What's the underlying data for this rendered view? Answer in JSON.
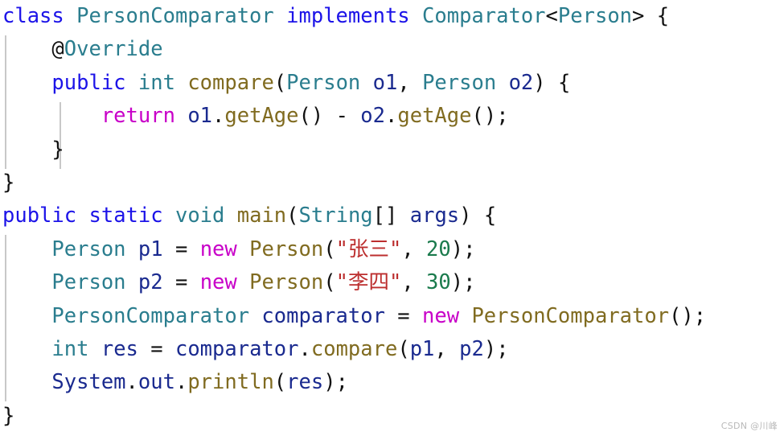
{
  "editor": {
    "language": "java",
    "background_color": "#ffffff",
    "font_size_px": 25.5,
    "line_height_px": 41.4,
    "total_lines": 13,
    "palette": {
      "keyword": "#1c13e8",
      "type": "#2a7d8e",
      "identifier": "#1a2a8f",
      "method": "#806b20",
      "control": "#c800c8",
      "string": "#bc2e2e",
      "number": "#1a7a4c",
      "punctuation": "#111111",
      "indent_guide": "#c8c8c8",
      "watermark": "#b9b9b9"
    },
    "full_source": "class PersonComparator implements Comparator<Person> {\n    @Override\n    public int compare(Person o1, Person o2) {\n        return o1.getAge() - o2.getAge();\n    }\n}\npublic static void main(String[] args) {\n    Person p1 = new Person(\"张三\", 20);\n    Person p2 = new Person(\"李四\", 30);\n    PersonComparator comparator = new PersonComparator();\n    int res = comparator.compare(p1, p2);\n    System.out.println(res);\n}",
    "lines": [
      {
        "n": 1,
        "text": "class PersonComparator implements Comparator<Person> {"
      },
      {
        "n": 2,
        "text": "    @Override"
      },
      {
        "n": 3,
        "text": "    public int compare(Person o1, Person o2) {"
      },
      {
        "n": 4,
        "text": "        return o1.getAge() - o2.getAge();"
      },
      {
        "n": 5,
        "text": "    }"
      },
      {
        "n": 6,
        "text": "}"
      },
      {
        "n": 7,
        "text": "public static void main(String[] args) {"
      },
      {
        "n": 8,
        "text": "    Person p1 = new Person(\"张三\", 20);"
      },
      {
        "n": 9,
        "text": "    Person p2 = new Person(\"李四\", 30);"
      },
      {
        "n": 10,
        "text": "    PersonComparator comparator = new PersonComparator();"
      },
      {
        "n": 11,
        "text": "    int res = comparator.compare(p1, p2);"
      },
      {
        "n": 12,
        "text": "    System.out.println(res);"
      },
      {
        "n": 13,
        "text": "}"
      }
    ],
    "tokens": {
      "l1": {
        "kw_class": "class",
        "sp1": " ",
        "type_name": "PersonComparator",
        "sp2": " ",
        "kw_implements": "implements",
        "sp3": " ",
        "iface": "Comparator",
        "lt": "<",
        "generic": "Person",
        "gt": ">",
        "sp4": " ",
        "brace": "{"
      },
      "l2": {
        "indent": "    ",
        "at": "@",
        "anno": "Override"
      },
      "l3": {
        "indent": "    ",
        "kw_public": "public",
        "sp1": " ",
        "type_int": "int",
        "sp2": " ",
        "method": "compare",
        "lparen": "(",
        "type_a": "Person",
        "sp3": " ",
        "arg_a": "o1",
        "comma": ", ",
        "type_b": "Person",
        "sp4": " ",
        "arg_b": "o2",
        "rparen": ")",
        "sp5": " ",
        "brace": "{"
      },
      "l4": {
        "indent": "        ",
        "kw_return": "return",
        "sp1": " ",
        "obj_a": "o1",
        "dot1": ".",
        "call_a": "getAge",
        "paren_a": "()",
        "op": " - ",
        "obj_b": "o2",
        "dot2": ".",
        "call_b": "getAge",
        "paren_b": "()",
        "semi": ";"
      },
      "l5": {
        "indent": "    ",
        "brace": "}"
      },
      "l6": {
        "brace": "}"
      },
      "l7": {
        "kw_public": "public",
        "sp1": " ",
        "kw_static": "static",
        "sp2": " ",
        "type_void": "void",
        "sp3": " ",
        "method": "main",
        "lparen": "(",
        "type_string": "String",
        "brackets": "[]",
        "sp4": " ",
        "arg": "args",
        "rparen": ")",
        "sp5": " ",
        "brace": "{"
      },
      "l8": {
        "indent": "    ",
        "type": "Person",
        "sp1": " ",
        "var": "p1",
        "eq": " = ",
        "kw_new": "new",
        "sp2": " ",
        "ctor": "Person",
        "lparen": "(",
        "str": "\"张三\"",
        "comma": ", ",
        "num": "20",
        "rparen": ")",
        "semi": ";"
      },
      "l9": {
        "indent": "    ",
        "type": "Person",
        "sp1": " ",
        "var": "p2",
        "eq": " = ",
        "kw_new": "new",
        "sp2": " ",
        "ctor": "Person",
        "lparen": "(",
        "str": "\"李四\"",
        "comma": ", ",
        "num": "30",
        "rparen": ")",
        "semi": ";"
      },
      "l10": {
        "indent": "    ",
        "type": "PersonComparator",
        "sp1": " ",
        "var": "comparator",
        "eq": " = ",
        "kw_new": "new",
        "sp2": " ",
        "ctor": "PersonComparator",
        "parens": "()",
        "semi": ";"
      },
      "l11": {
        "indent": "    ",
        "type_int": "int",
        "sp1": " ",
        "var": "res",
        "eq": " = ",
        "obj": "comparator",
        "dot": ".",
        "method": "compare",
        "lparen": "(",
        "arg_a": "p1",
        "comma": ", ",
        "arg_b": "p2",
        "rparen": ")",
        "semi": ";"
      },
      "l12": {
        "indent": "    ",
        "sys": "System",
        "dot1": ".",
        "out": "out",
        "dot2": ".",
        "method": "println",
        "lparen": "(",
        "arg": "res",
        "rparen": ")",
        "semi": ";"
      },
      "l13": {
        "brace": "}"
      }
    }
  },
  "watermark": {
    "text": "CSDN @川峰"
  }
}
